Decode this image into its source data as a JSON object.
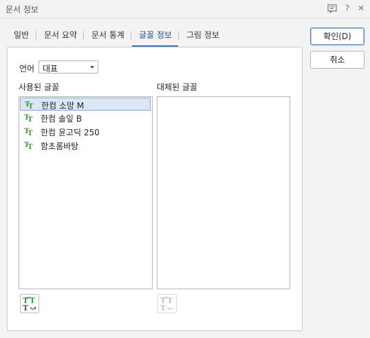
{
  "window": {
    "title": "문서 정보",
    "help_label": "?",
    "close_label": "✕"
  },
  "tabs": [
    {
      "label": "일반",
      "active": false
    },
    {
      "label": "문서 요약",
      "active": false
    },
    {
      "label": "문서 통계",
      "active": false
    },
    {
      "label": "글꼴 정보",
      "active": true
    },
    {
      "label": "그림 정보",
      "active": false
    }
  ],
  "language": {
    "label": "언어",
    "selected": "대표"
  },
  "used_fonts": {
    "label": "사용된 글꼴",
    "items": [
      {
        "name": "한컴 소망 M",
        "selected": true
      },
      {
        "name": "한컴 솔잎 B",
        "selected": false
      },
      {
        "name": "한컴 윤고딕 250",
        "selected": false
      },
      {
        "name": "함초롬바탕",
        "selected": false
      }
    ]
  },
  "replaced_fonts": {
    "label": "대체된 글꼴",
    "items": []
  },
  "buttons": {
    "ok_label": "확인(D)",
    "cancel_label": "취소"
  },
  "colors": {
    "accent": "#3b76c4",
    "font_icon_green": "#3e9a3a",
    "selection_bg": "#dde6f6"
  }
}
